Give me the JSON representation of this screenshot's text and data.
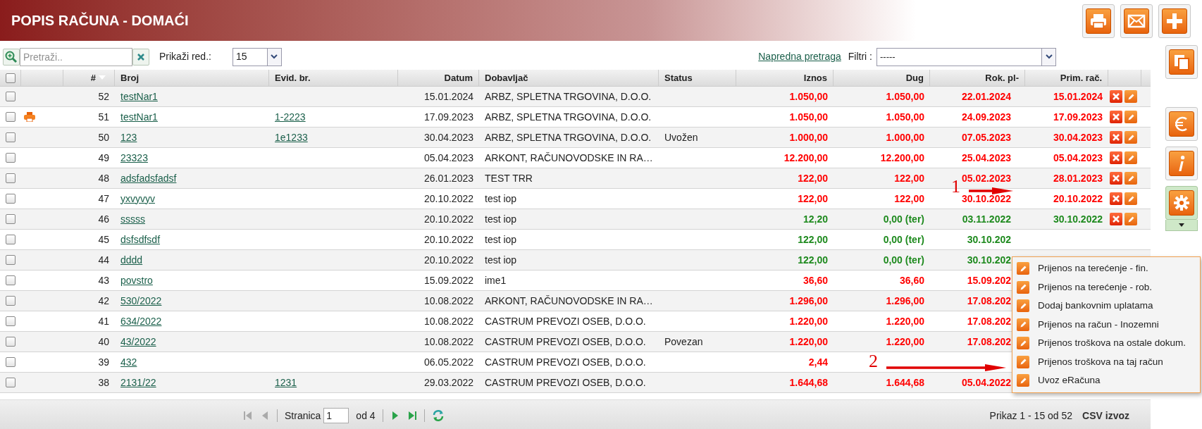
{
  "title": "POPIS RAČUNA - DOMAĆI",
  "top_buttons": [
    {
      "kind": "print"
    },
    {
      "kind": "mail"
    },
    {
      "kind": "add"
    }
  ],
  "side_buttons": [
    {
      "kind": "copy",
      "selected": false
    },
    {
      "kind": "euro",
      "selected": false
    },
    {
      "kind": "info",
      "selected": false
    },
    {
      "kind": "gear",
      "selected": true
    }
  ],
  "toolbar": {
    "search_placeholder": "Pretraži..",
    "rows_label": "Prikaži red.:",
    "rows_value": "15",
    "advanced_link": "Napredna pretraga",
    "filter_label": "Filtri :",
    "filter_value": "-----"
  },
  "select_all_checked": false,
  "columns": [
    "#",
    "Broj",
    "Evid. br.",
    "Datum",
    "Dobavljač",
    "Status",
    "Iznos",
    "Dug",
    "Rok. pl-",
    "Prim. rač."
  ],
  "rows": [
    {
      "checked": false,
      "num": "52",
      "printed": false,
      "broj": "testNar1",
      "evid": "",
      "datum": "15.01.2024",
      "dobavljac": "ARBZ, SPLETNA TRGOVINA, D.O.O.",
      "status": "",
      "iznos": "1.050,00",
      "dug": "1.050,00",
      "rok": "22.01.2024",
      "prim": "15.01.2024",
      "overdue": true,
      "actions": true
    },
    {
      "checked": false,
      "num": "51",
      "printed": true,
      "broj": "testNar1",
      "evid": "1-2223",
      "datum": "17.09.2023",
      "dobavljac": "ARBZ, SPLETNA TRGOVINA, D.O.O.",
      "status": "",
      "iznos": "1.050,00",
      "dug": "1.050,00",
      "rok": "24.09.2023",
      "prim": "17.09.2023",
      "overdue": true,
      "actions": true
    },
    {
      "checked": false,
      "num": "50",
      "printed": false,
      "broj": "123",
      "evid": "1e1233",
      "datum": "30.04.2023",
      "dobavljac": "ARBZ, SPLETNA TRGOVINA, D.O.O.",
      "status": "Uvožen",
      "iznos": "1.000,00",
      "dug": "1.000,00",
      "rok": "07.05.2023",
      "prim": "30.04.2023",
      "overdue": true,
      "actions": true
    },
    {
      "checked": false,
      "num": "49",
      "printed": false,
      "broj": "23323",
      "evid": "",
      "datum": "05.04.2023",
      "dobavljac": "ARKONT, RAČUNOVODSKE IN RA…",
      "status": "",
      "iznos": "12.200,00",
      "dug": "12.200,00",
      "rok": "25.04.2023",
      "prim": "05.04.2023",
      "overdue": true,
      "actions": true
    },
    {
      "checked": false,
      "num": "48",
      "printed": false,
      "broj": "adsfadsfadsf",
      "evid": "",
      "datum": "26.01.2023",
      "dobavljac": "TEST TRR",
      "status": "",
      "iznos": "122,00",
      "dug": "122,00",
      "rok": "05.02.2023",
      "prim": "28.01.2023",
      "overdue": true,
      "actions": true
    },
    {
      "checked": false,
      "num": "47",
      "printed": false,
      "broj": "yxvyvyv",
      "evid": "",
      "datum": "20.10.2022",
      "dobavljac": "test iop",
      "status": "",
      "iznos": "122,00",
      "dug": "122,00",
      "rok": "30.10.2022",
      "prim": "20.10.2022",
      "overdue": true,
      "actions": true
    },
    {
      "checked": false,
      "num": "46",
      "printed": false,
      "broj": "sssss",
      "evid": "",
      "datum": "20.10.2022",
      "dobavljac": "test iop",
      "status": "",
      "iznos": "12,20",
      "dug": "0,00 (ter)",
      "rok": "03.11.2022",
      "prim": "30.10.2022",
      "overdue": false,
      "actions": true
    },
    {
      "checked": false,
      "num": "45",
      "printed": false,
      "broj": "dsfsdfsdf",
      "evid": "",
      "datum": "20.10.2022",
      "dobavljac": "test iop",
      "status": "",
      "iznos": "122,00",
      "dug": "0,00 (ter)",
      "rok": "30.10.202",
      "prim": "",
      "overdue": false,
      "actions": false
    },
    {
      "checked": false,
      "num": "44",
      "printed": false,
      "broj": "dddd",
      "evid": "",
      "datum": "20.10.2022",
      "dobavljac": "test iop",
      "status": "",
      "iznos": "122,00",
      "dug": "0,00 (ter)",
      "rok": "30.10.202",
      "prim": "",
      "overdue": false,
      "actions": false
    },
    {
      "checked": false,
      "num": "43",
      "printed": false,
      "broj": "povstro",
      "evid": "",
      "datum": "15.09.2022",
      "dobavljac": "ime1",
      "status": "",
      "iznos": "36,60",
      "dug": "36,60",
      "rok": "15.09.202",
      "prim": "",
      "overdue": true,
      "actions": false
    },
    {
      "checked": false,
      "num": "42",
      "printed": false,
      "broj": "530/2022",
      "evid": "",
      "datum": "10.08.2022",
      "dobavljac": "ARKONT, RAČUNOVODSKE IN RA…",
      "status": "",
      "iznos": "1.296,00",
      "dug": "1.296,00",
      "rok": "17.08.202",
      "prim": "",
      "overdue": true,
      "actions": false
    },
    {
      "checked": false,
      "num": "41",
      "printed": false,
      "broj": "634/2022",
      "evid": "",
      "datum": "10.08.2022",
      "dobavljac": "CASTRUM PREVOZI OSEB, D.O.O.",
      "status": "",
      "iznos": "1.220,00",
      "dug": "1.220,00",
      "rok": "17.08.202",
      "prim": "",
      "overdue": true,
      "actions": false
    },
    {
      "checked": false,
      "num": "40",
      "printed": false,
      "broj": "43/2022",
      "evid": "",
      "datum": "10.08.2022",
      "dobavljac": "CASTRUM PREVOZI OSEB, D.O.O.",
      "status": "Povezan",
      "iznos": "1.220,00",
      "dug": "1.220,00",
      "rok": "17.08.202",
      "prim": "",
      "overdue": true,
      "actions": false
    },
    {
      "checked": false,
      "num": "39",
      "printed": false,
      "broj": "432",
      "evid": "",
      "datum": "06.05.2022",
      "dobavljac": "CASTRUM PREVOZI OSEB, D.O.O.",
      "status": "",
      "iznos": "2,44",
      "dug": "",
      "rok": "",
      "prim": "",
      "overdue": true,
      "actions": false
    },
    {
      "checked": false,
      "num": "38",
      "printed": false,
      "broj": "2131/22",
      "evid": "1231",
      "datum": "29.03.2022",
      "dobavljac": "CASTRUM PREVOZI OSEB, D.O.O.",
      "status": "",
      "iznos": "1.644,68",
      "dug": "1.644,68",
      "rok": "05.04.2022",
      "prim": "",
      "overdue": true,
      "actions": false
    }
  ],
  "menu": [
    "Prijenos na terećenje - fin.",
    "Prijenos na terećenje - rob.",
    "Dodaj bankovnim uplatama",
    "Prijenos na račun - Inozemni",
    "Prijenos troškova na ostale dokum.",
    "Prijenos troškova na taj račun",
    "Uvoz eRačuna"
  ],
  "annotations": [
    {
      "label": "1"
    },
    {
      "label": "2"
    }
  ],
  "pager": {
    "page_label": "Stranica",
    "page_value": "1",
    "of_label": "od 4",
    "summary": "Prikaz 1 - 15 od 52",
    "csv": "CSV izvoz"
  }
}
